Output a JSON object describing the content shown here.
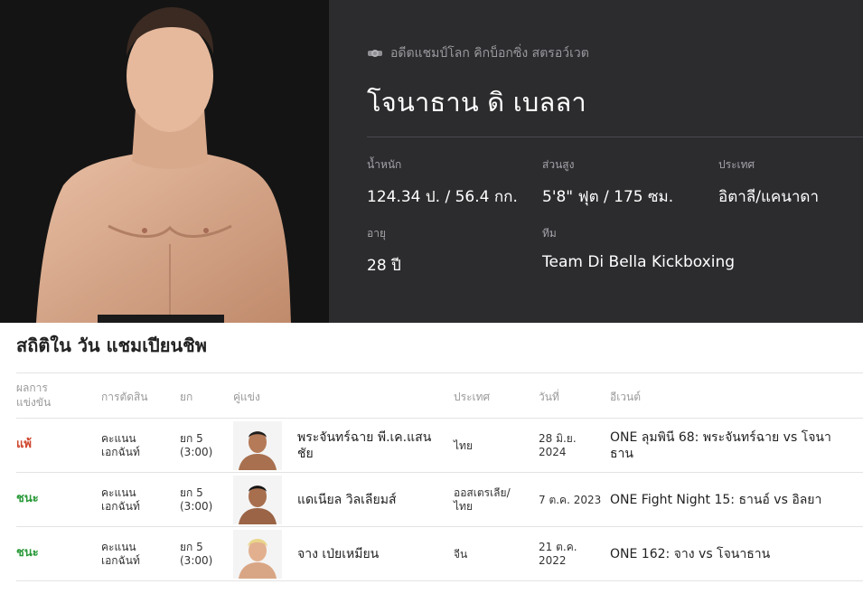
{
  "profile": {
    "title_badge": "อดีตแชมป์โลก คิกบ็อกซิ่ง สตรอว์เวต",
    "name": "โจนาธาน ดิ เบลลา",
    "stats": {
      "weight_label": "น้ำหนัก",
      "weight_value": "124.34 ป. / 56.4 กก.",
      "height_label": "ส่วนสูง",
      "height_value": "5'8\" ฟุต / 175 ซม.",
      "country_label": "ประเทศ",
      "country_value": "อิตาลี/แคนาดา",
      "age_label": "อายุ",
      "age_value": "28 ปี",
      "team_label": "ทีม",
      "team_value": "Team Di Bella Kickboxing"
    }
  },
  "record": {
    "section_title": "สถิติใน วัน แชมเปียนชิพ",
    "headers": {
      "result": "ผลการ แข่งขัน",
      "method": "การตัดสิน",
      "round": "ยก",
      "opponent": "คู่แข่ง",
      "country": "ประเทศ",
      "date": "วันที่",
      "event": "อีเวนต์"
    },
    "rows": [
      {
        "result": "แพ้",
        "method": "คะแนน เอกฉันท์",
        "round": "ยก 5 (3:00)",
        "opponent": "พระจันทร์ฉาย พี.เค.แสนชัย",
        "country": "ไทย",
        "date": "28 มิ.ย. 2024",
        "event": "ONE ลุมพินี 68: พระจันทร์ฉาย vs โจนาธาน"
      },
      {
        "result": "ชนะ",
        "method": "คะแนน เอกฉันท์",
        "round": "ยก 5 (3:00)",
        "opponent": "แดเนียล วิลเลียมส์",
        "country": "ออสเตรเลีย/ ไทย",
        "date": "7 ต.ค. 2023",
        "event": "ONE Fight Night 15: ธานอ์ vs อิลยา"
      },
      {
        "result": "ชนะ",
        "method": "คะแนน เอกฉันท์",
        "round": "ยก 5 (3:00)",
        "opponent": "จาง เป่ยเหมียน",
        "country": "จีน",
        "date": "21 ต.ค. 2022",
        "event": "ONE 162: จาง vs โจนาธาน"
      }
    ]
  },
  "colors": {
    "loss": "#d0462e",
    "win": "#2a9a3a",
    "hero_bg": "#2c2c2f"
  }
}
